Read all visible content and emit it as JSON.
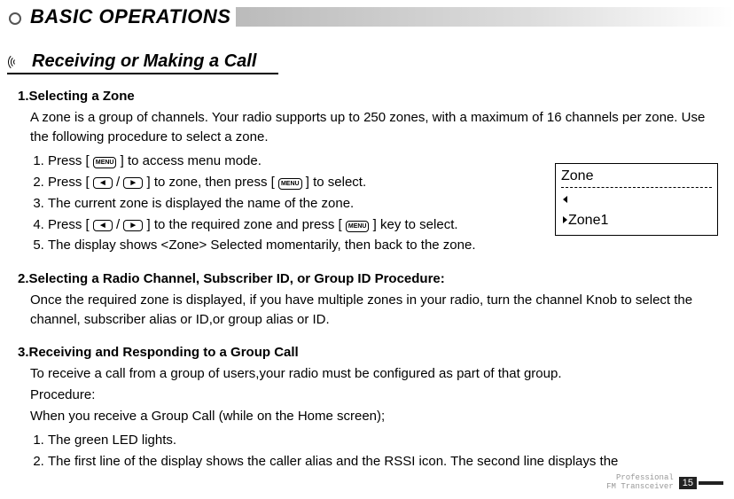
{
  "chapter_title": "BASIC OPERATIONS",
  "section_title": "Receiving or Making a Call",
  "sec1": {
    "head": "1.Selecting a Zone",
    "intro": "A zone is a group of channels. Your radio supports up to 250 zones, with a maximum of 16 channels per zone. Use the following procedure to select a zone.",
    "s1a": "Press [ ",
    "s1b": " ] to access menu mode.",
    "s2a": " Press [ ",
    "s2b": " / ",
    "s2c": " ] to zone, then press [ ",
    "s2d": " ] to select.",
    "s3": "The current zone is displayed the name of the zone.",
    "s4a": "Press [ ",
    "s4b": " / ",
    "s4c": " ] to the required zone and press [ ",
    "s4d": " ] key to select.",
    "s5": "The display shows <Zone> Selected momentarily, then back to the zone."
  },
  "sec2": {
    "head": "2.Selecting a Radio Channel, Subscriber ID, or Group ID Procedure:",
    "body": "Once the required zone is displayed, if you have multiple zones in your radio, turn the channel Knob to select the channel, subscriber alias or ID,or group alias or ID."
  },
  "sec3": {
    "head": "3.Receiving and Responding to a Group Call",
    "l1": "To receive a call from a group of  users,your radio must be configured as part of that group.",
    "l2": "Procedure:",
    "l3": "When you  receive a Group Call (while on the  Home screen);",
    "s1": "The green LED lights.",
    "s2": "The first line of the display shows the caller alias and the RSSI icon. The second line displays the"
  },
  "zonebox": {
    "title": "Zone",
    "item": "Zone1"
  },
  "key_menu": "MENU",
  "key_left": "◄",
  "key_right": "►",
  "footer": {
    "l1": "Professional",
    "l2": "FM Transceiver",
    "page": "15"
  }
}
